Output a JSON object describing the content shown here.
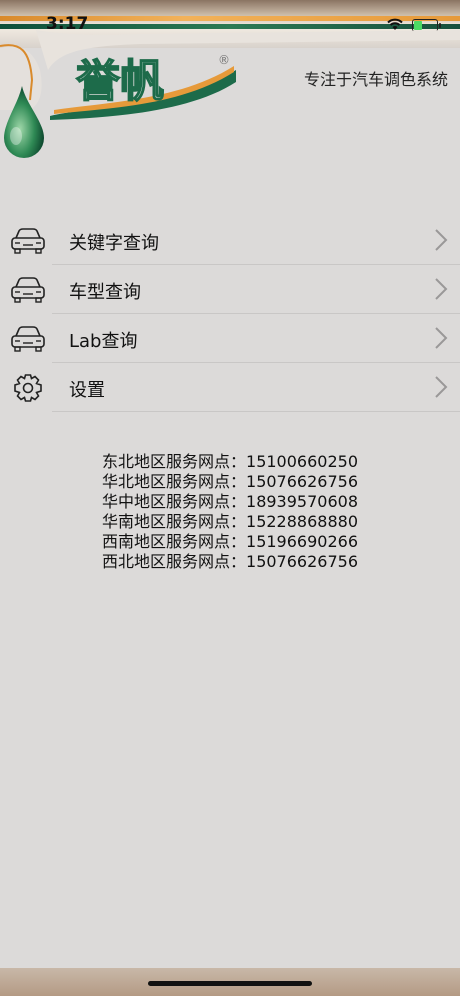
{
  "status_bar": {
    "time": "3:17",
    "battery_level": 0.35
  },
  "header": {
    "brand": "誉帆",
    "registered": "®",
    "tagline": "专注于汽车调色系统",
    "colors": {
      "orange": "#e69a3a",
      "green": "#1d6b4a"
    }
  },
  "menu": {
    "items": [
      {
        "label": "关键字查询",
        "icon": "car-icon"
      },
      {
        "label": "车型查询",
        "icon": "car-icon"
      },
      {
        "label": "Lab查询",
        "icon": "car-icon"
      },
      {
        "label": "设置",
        "icon": "gear-icon"
      }
    ]
  },
  "contacts": [
    {
      "region": "东北地区服务网点：",
      "phone": "15100660250"
    },
    {
      "region": "华北地区服务网点：",
      "phone": "15076626756"
    },
    {
      "region": "华中地区服务网点：",
      "phone": "18939570608"
    },
    {
      "region": "华南地区服务网点：",
      "phone": "15228868880"
    },
    {
      "region": "西南地区服务网点：",
      "phone": "15196690266"
    },
    {
      "region": "西北地区服务网点：",
      "phone": "15076626756"
    }
  ]
}
